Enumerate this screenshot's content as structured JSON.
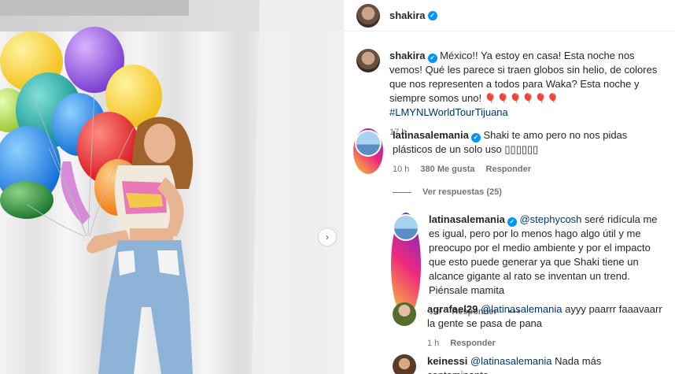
{
  "header": {
    "username": "shakira"
  },
  "caption": {
    "username": "shakira",
    "text": "México!! Ya estoy en casa! Esta noche nos vemos! Qué les parece si traen globos sin helio, de colores que nos representen a todos para Waka? Esta noche y siempre somos uno!",
    "emoji": "🎈🎈🎈🎈🎈🎈",
    "hashtag": "#LMYNLWorldTourTijuana",
    "time": "17 h"
  },
  "comment1": {
    "username": "latinasalemania",
    "text": "Shaki te amo pero no nos pidas plásticos de un solo uso",
    "boxes": "▯▯▯▯▯▯",
    "time": "10 h",
    "likes": "380 Me gusta",
    "reply": "Responder"
  },
  "view_replies": "Ver respuestas (25)",
  "reply1": {
    "username": "latinasalemania",
    "mention": "@stephycosh",
    "text": "seré ridícula me es igual, pero por lo menos hago algo útil y me preocupo por el medio ambiente y por el impacto que esto puede generar ya que Shaki tiene un alcance gigante al rato se inventan un trend. Piénsale mamita",
    "time": "1 h",
    "reply": "Responder",
    "more": "•••"
  },
  "reply2": {
    "username": "agrafael29",
    "mention": "@latinasalemania",
    "text": "ayyy paarrr faaavaarr la gente se pasa de pana",
    "time": "1 h",
    "reply": "Responder"
  },
  "reply3": {
    "username": "keinessi",
    "mention": "@latinasalemania",
    "text": "Nada más contaminante"
  },
  "icons": {
    "verified": "verified-badge-icon",
    "next": "chevron-right-icon"
  },
  "colors": {
    "link": "#00376b",
    "verified": "#0095f6",
    "muted": "#737373"
  }
}
